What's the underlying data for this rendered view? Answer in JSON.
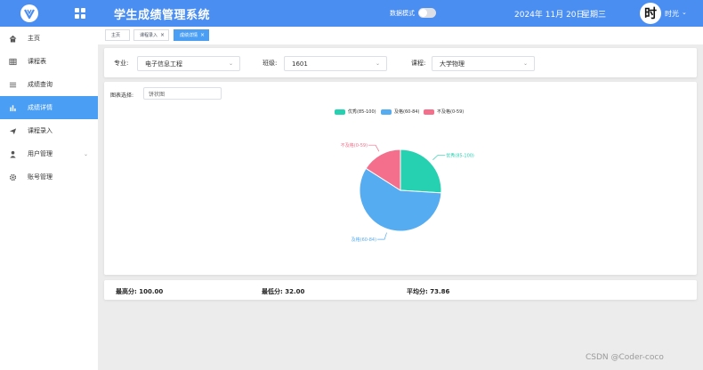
{
  "app": {
    "title": "学生成绩管理系统"
  },
  "header": {
    "data_mode_label": "数据模式",
    "date": "2024年 11月 20日",
    "weekday": "星期三",
    "avatar_char": "时",
    "user_name": "时光",
    "accent_color": "#4a8ef2"
  },
  "sidebar": {
    "items": [
      {
        "label": "主页",
        "icon": "home-icon"
      },
      {
        "label": "课程表",
        "icon": "table-icon"
      },
      {
        "label": "成绩查询",
        "icon": "list-icon"
      },
      {
        "label": "成绩详情",
        "icon": "bar-chart-icon",
        "active": true
      },
      {
        "label": "课程录入",
        "icon": "paper-plane-icon"
      },
      {
        "label": "用户管理",
        "icon": "user-icon",
        "expandable": true
      },
      {
        "label": "账号管理",
        "icon": "gear-icon"
      }
    ]
  },
  "tabs": [
    {
      "label": "主页"
    },
    {
      "label": "课程录入"
    },
    {
      "label": "成绩详情",
      "active": true
    }
  ],
  "filters": {
    "major_label": "专业:",
    "major_value": "电子信息工程",
    "class_label": "班级:",
    "class_value": "1601",
    "course_label": "课程:",
    "course_value": "大学物理"
  },
  "chart_controls": {
    "label": "图表选择:",
    "value": "饼状图"
  },
  "chart_data": {
    "type": "pie",
    "slices": [
      {
        "name": "优秀(85-100)",
        "value": 26,
        "color": "#26d1b1"
      },
      {
        "name": "及格(60-84)",
        "value": 58,
        "color": "#55acf1"
      },
      {
        "name": "不及格(0-59)",
        "value": 16,
        "color": "#f46f8b"
      }
    ],
    "legend_position": "top"
  },
  "stats": {
    "max": "最高分: 100.00",
    "min": "最低分: 32.00",
    "avg": "平均分: 73.86"
  },
  "watermark": "CSDN @Coder-coco"
}
